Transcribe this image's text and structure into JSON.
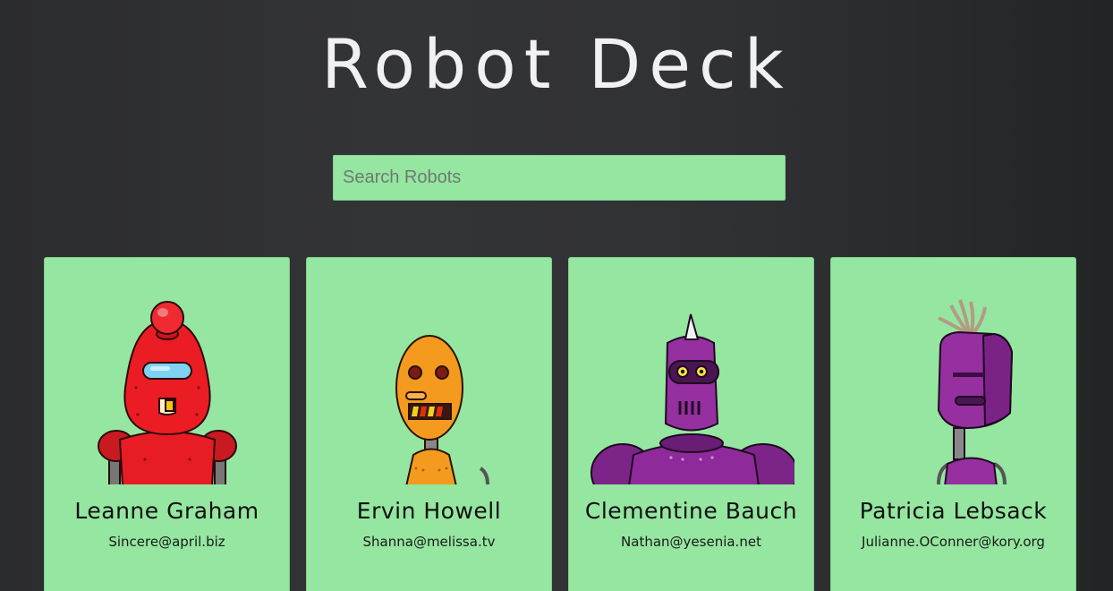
{
  "app": {
    "title": "Robot Deck"
  },
  "search": {
    "placeholder": "Search Robots",
    "value": ""
  },
  "robots": [
    {
      "name": "Leanne Graham",
      "email": "Sincere@april.biz",
      "color": "#ec1c24"
    },
    {
      "name": "Ervin Howell",
      "email": "Shanna@melissa.tv",
      "color": "#f39a1f"
    },
    {
      "name": "Clementine Bauch",
      "email": "Nathan@yesenia.net",
      "color": "#8e2a9a"
    },
    {
      "name": "Patricia Lebsack",
      "email": "Julianne.OConner@kory.org",
      "color": "#962fa0"
    }
  ],
  "colors": {
    "card_background": "#95e6a0",
    "page_background": "#2e2f31",
    "title_text": "#f1f1f3"
  }
}
